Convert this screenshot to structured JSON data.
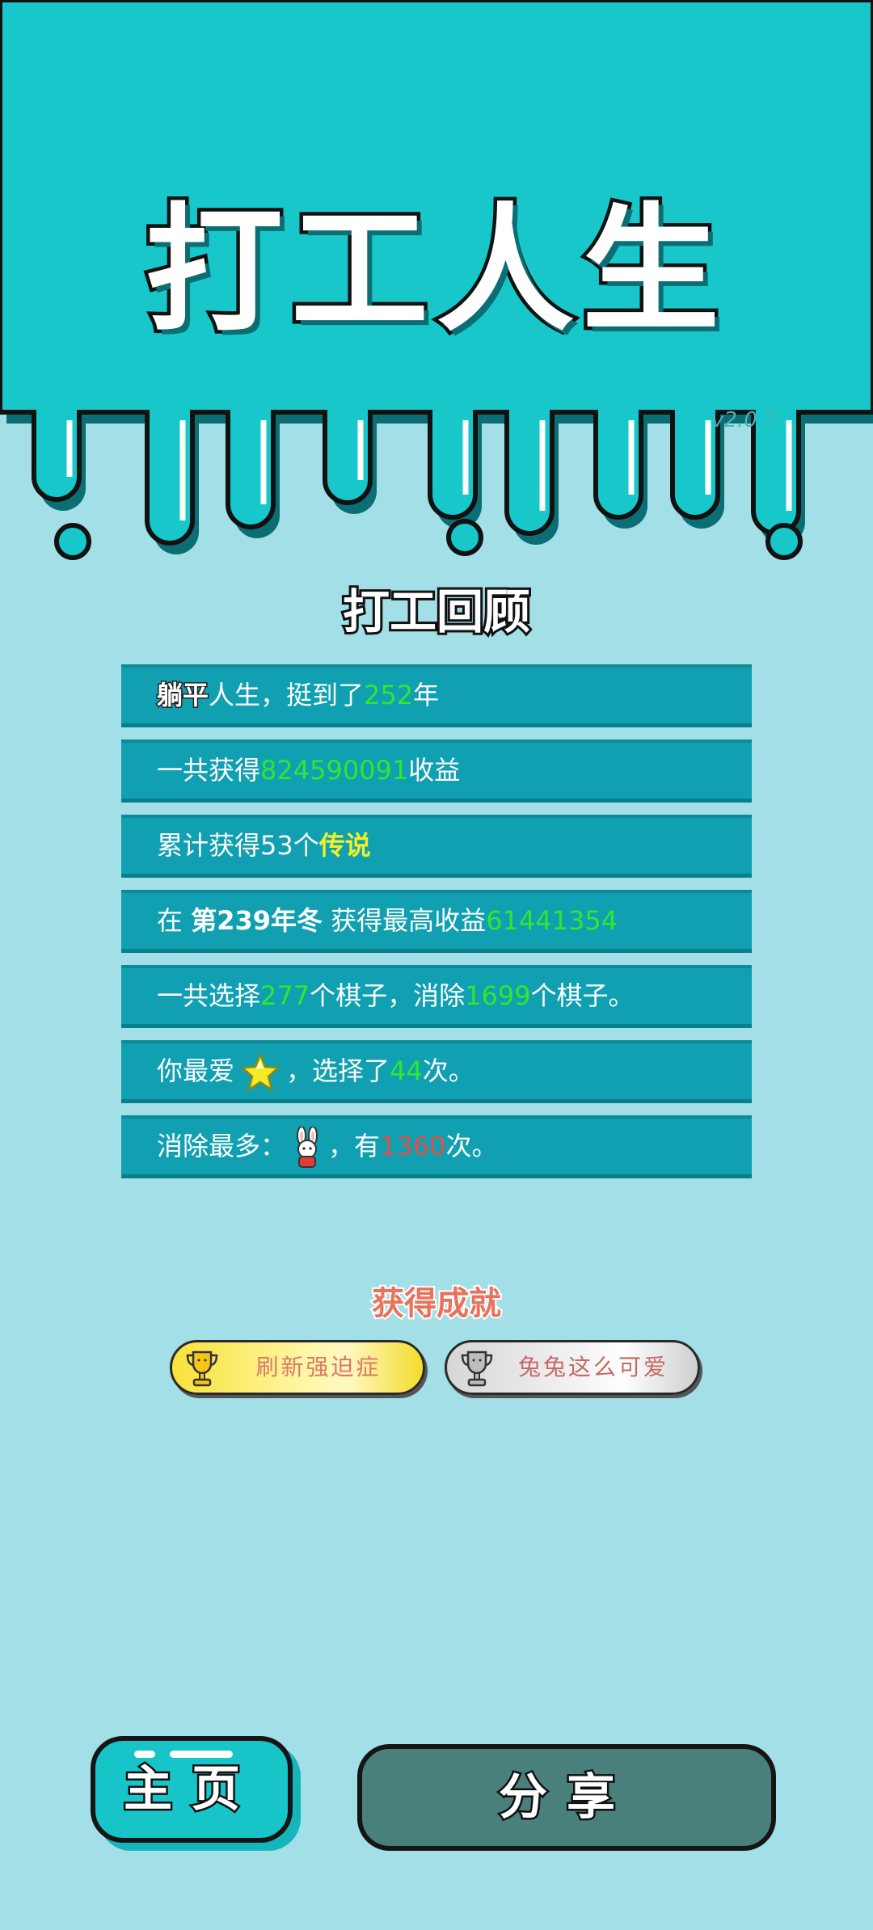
{
  "game": {
    "title": "打工人生",
    "version": "v2.0.7"
  },
  "review": {
    "title": "打工回顾",
    "rows": [
      {
        "pre": "人生，挺到了",
        "value": "252",
        "post": "年",
        "prefix_bold": "躺平"
      },
      {
        "pre": "一共获得",
        "value": "824590091",
        "post": "收益"
      },
      {
        "pre": "累计获得53个",
        "highlight": "传说"
      },
      {
        "pre": "在 ",
        "bold": "第239年冬",
        "mid": " 获得最高收益",
        "value": "61441354"
      },
      {
        "pre": "一共选择",
        "value": "277",
        "mid": "个棋子，消除",
        "value2": "1699",
        "post": "个棋子。"
      },
      {
        "pre": "你最爱",
        "icon": "star-icon",
        "mid": "，选择了",
        "value": "44",
        "post": "次。"
      },
      {
        "pre": "消除最多：",
        "icon": "rabbit-icon",
        "mid": "，有",
        "value": "1360",
        "post": "次。"
      }
    ]
  },
  "achievements": {
    "title": "获得成就",
    "items": [
      {
        "label": "刷新强迫症",
        "style": "gold",
        "icon": "trophy-icon"
      },
      {
        "label": "兔兔这么可爱",
        "style": "silver",
        "icon": "trophy-icon"
      }
    ]
  },
  "buttons": {
    "home": "主页",
    "share": "分享"
  },
  "colors": {
    "background": "#a2dfe6",
    "header": "#17c7c9",
    "row": "#11a0b2",
    "green_value": "#2ee82e",
    "yellow_highlight": "#f0f028",
    "red_value": "#e0504a"
  }
}
